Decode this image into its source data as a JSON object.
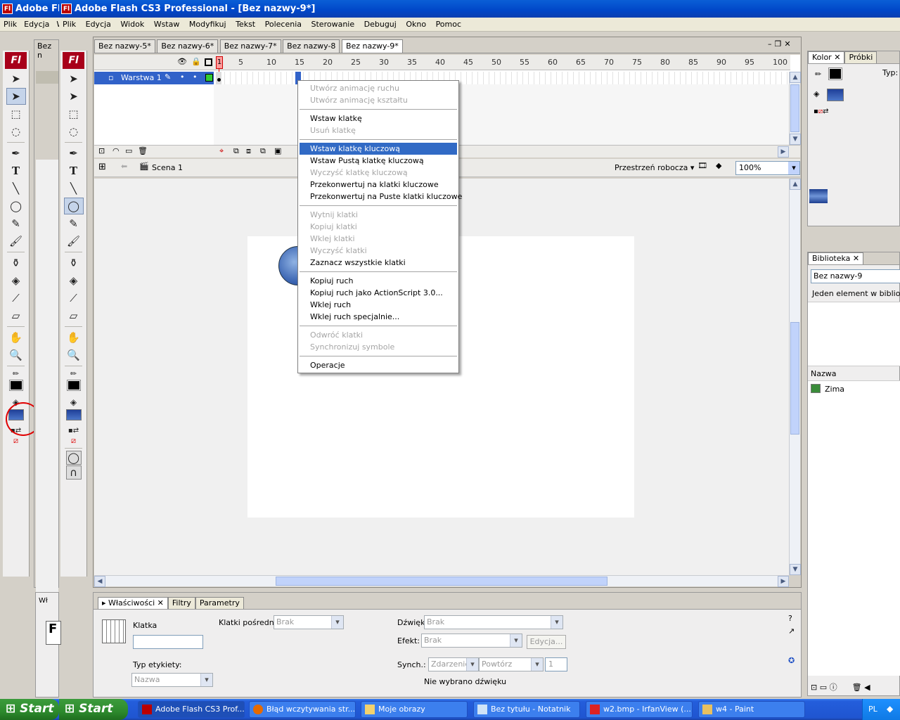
{
  "back_window": {
    "title": "Adobe Fla",
    "menu": [
      "Plik",
      "Edycja",
      "W"
    ],
    "tab_fragment": "Bez n"
  },
  "window": {
    "title": "Adobe Flash CS3 Professional - [Bez nazwy-9*]",
    "icon_label": "Fl",
    "menu": [
      "Plik",
      "Edycja",
      "Widok",
      "Wstaw",
      "Modyfikuj",
      "Tekst",
      "Polecenia",
      "Sterowanie",
      "Debuguj",
      "Okno",
      "Pomoc"
    ]
  },
  "toolbar": {
    "logo": "Fl"
  },
  "doc_tabs": [
    "Bez nazwy-5*",
    "Bez nazwy-6*",
    "Bez nazwy-7*",
    "Bez nazwy-8",
    "Bez nazwy-9*"
  ],
  "timeline": {
    "ruler": [
      "1",
      "5",
      "10",
      "15",
      "20",
      "25",
      "30",
      "35",
      "40",
      "45",
      "50",
      "55",
      "60",
      "65",
      "70",
      "75",
      "80",
      "85",
      "90",
      "95",
      "100"
    ],
    "layer_name": "Warstwa 1",
    "current_frame_marker": "1"
  },
  "edit_bar": {
    "scene": "Scena 1",
    "workspace": "Przestrzeń robocza ▾",
    "zoom": "100%"
  },
  "context_menu": {
    "items": [
      {
        "label": "Utwórz animację ruchu",
        "enabled": false
      },
      {
        "label": "Utwórz animację kształtu",
        "enabled": false
      },
      {
        "sep": true
      },
      {
        "label": "Wstaw klatkę",
        "enabled": true
      },
      {
        "label": "Usuń klatkę",
        "enabled": false
      },
      {
        "sep": true
      },
      {
        "label": "Wstaw klatkę kluczową",
        "enabled": true,
        "highlighted": true
      },
      {
        "label": "Wstaw Pustą klatkę kluczową",
        "enabled": true
      },
      {
        "label": "Wyczyść klatkę kluczową",
        "enabled": false
      },
      {
        "label": "Przekonwertuj na klatki kluczowe",
        "enabled": true
      },
      {
        "label": "Przekonwertuj na Puste klatki kluczowe",
        "enabled": true
      },
      {
        "sep": true
      },
      {
        "label": "Wytnij klatki",
        "enabled": false
      },
      {
        "label": "Kopiuj klatki",
        "enabled": false
      },
      {
        "label": "Wklej klatki",
        "enabled": false
      },
      {
        "label": "Wyczyść klatki",
        "enabled": false
      },
      {
        "label": "Zaznacz wszystkie klatki",
        "enabled": true
      },
      {
        "sep": true
      },
      {
        "label": "Kopiuj ruch",
        "enabled": true
      },
      {
        "label": "Kopiuj ruch jako ActionScript 3.0...",
        "enabled": true
      },
      {
        "label": "Wklej ruch",
        "enabled": true
      },
      {
        "label": "Wklej ruch specjalnie...",
        "enabled": true
      },
      {
        "sep": true
      },
      {
        "label": "Odwróć klatki",
        "enabled": false
      },
      {
        "label": "Synchronizuj symbole",
        "enabled": false
      },
      {
        "sep": true
      },
      {
        "label": "Operacje",
        "enabled": true
      }
    ]
  },
  "color_panel": {
    "tabs": [
      "Kolor",
      "Próbki"
    ],
    "type_label": "Typ:"
  },
  "library_panel": {
    "tab": "Biblioteka",
    "doc": "Bez nazwy-9",
    "count": "Jeden element w bibliotece",
    "col_name": "Nazwa",
    "items": [
      "Zima"
    ]
  },
  "properties_panel": {
    "tabs": [
      "Właściwości",
      "Filtry",
      "Parametry"
    ],
    "frame_label": "Klatka",
    "label_type": "Typ etykiety:",
    "label_type_value": "Nazwa",
    "tween_label": "Klatki pośredn.:",
    "tween_value": "Brak",
    "sound_label": "Dźwięk:",
    "sound_value": "Brak",
    "effect_label": "Efekt:",
    "effect_value": "Brak",
    "edit_button": "Edycja...",
    "sync_label": "Synch.:",
    "sync_value": "Zdarzenie",
    "repeat_value": "Powtórz",
    "repeat_count": "1",
    "no_sound": "Nie wybrano dźwięku"
  },
  "back_panel_fragment": "Wł",
  "taskbar": {
    "start": "Start",
    "tasks": [
      {
        "label": "Adobe Flash CS3 Prof...",
        "active": true
      },
      {
        "label": "Błąd wczytywania str...",
        "active": false
      },
      {
        "label": "Moje obrazy",
        "active": false
      },
      {
        "label": "Bez tytułu - Notatnik",
        "active": false
      },
      {
        "label": "w2.bmp - IrfanView (...",
        "active": false
      },
      {
        "label": "w4 - Paint",
        "active": false
      }
    ],
    "lang": "PL"
  },
  "colors": {
    "accent_highlight": "#316ac5",
    "title_blue": "#0a5fd6",
    "flash_red": "#a8001a",
    "annotation_circle": "#e00000"
  }
}
